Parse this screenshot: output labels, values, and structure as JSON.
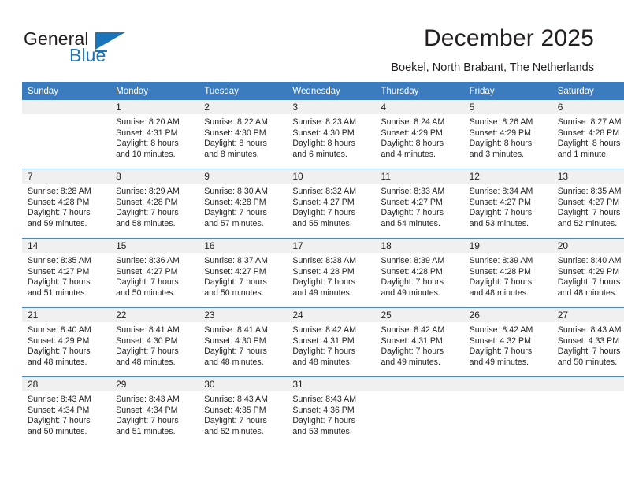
{
  "brand": {
    "name_part1": "General",
    "name_part2": "Blue"
  },
  "header": {
    "title": "December 2025",
    "subtitle": "Boekel, North Brabant, The Netherlands"
  },
  "colors": {
    "header_blue": "#3b7cbf",
    "brand_blue": "#1b75bb",
    "daynum_band": "#f0f0f0",
    "row_divider": "#4f86c2",
    "text": "#231f20"
  },
  "calendar": {
    "weekday_headers": [
      "Sunday",
      "Monday",
      "Tuesday",
      "Wednesday",
      "Thursday",
      "Friday",
      "Saturday"
    ],
    "weeks": [
      [
        {
          "day": "",
          "lines": []
        },
        {
          "day": "1",
          "lines": [
            "Sunrise: 8:20 AM",
            "Sunset: 4:31 PM",
            "Daylight: 8 hours",
            "and 10 minutes."
          ]
        },
        {
          "day": "2",
          "lines": [
            "Sunrise: 8:22 AM",
            "Sunset: 4:30 PM",
            "Daylight: 8 hours",
            "and 8 minutes."
          ]
        },
        {
          "day": "3",
          "lines": [
            "Sunrise: 8:23 AM",
            "Sunset: 4:30 PM",
            "Daylight: 8 hours",
            "and 6 minutes."
          ]
        },
        {
          "day": "4",
          "lines": [
            "Sunrise: 8:24 AM",
            "Sunset: 4:29 PM",
            "Daylight: 8 hours",
            "and 4 minutes."
          ]
        },
        {
          "day": "5",
          "lines": [
            "Sunrise: 8:26 AM",
            "Sunset: 4:29 PM",
            "Daylight: 8 hours",
            "and 3 minutes."
          ]
        },
        {
          "day": "6",
          "lines": [
            "Sunrise: 8:27 AM",
            "Sunset: 4:28 PM",
            "Daylight: 8 hours",
            "and 1 minute."
          ]
        }
      ],
      [
        {
          "day": "7",
          "lines": [
            "Sunrise: 8:28 AM",
            "Sunset: 4:28 PM",
            "Daylight: 7 hours",
            "and 59 minutes."
          ]
        },
        {
          "day": "8",
          "lines": [
            "Sunrise: 8:29 AM",
            "Sunset: 4:28 PM",
            "Daylight: 7 hours",
            "and 58 minutes."
          ]
        },
        {
          "day": "9",
          "lines": [
            "Sunrise: 8:30 AM",
            "Sunset: 4:28 PM",
            "Daylight: 7 hours",
            "and 57 minutes."
          ]
        },
        {
          "day": "10",
          "lines": [
            "Sunrise: 8:32 AM",
            "Sunset: 4:27 PM",
            "Daylight: 7 hours",
            "and 55 minutes."
          ]
        },
        {
          "day": "11",
          "lines": [
            "Sunrise: 8:33 AM",
            "Sunset: 4:27 PM",
            "Daylight: 7 hours",
            "and 54 minutes."
          ]
        },
        {
          "day": "12",
          "lines": [
            "Sunrise: 8:34 AM",
            "Sunset: 4:27 PM",
            "Daylight: 7 hours",
            "and 53 minutes."
          ]
        },
        {
          "day": "13",
          "lines": [
            "Sunrise: 8:35 AM",
            "Sunset: 4:27 PM",
            "Daylight: 7 hours",
            "and 52 minutes."
          ]
        }
      ],
      [
        {
          "day": "14",
          "lines": [
            "Sunrise: 8:35 AM",
            "Sunset: 4:27 PM",
            "Daylight: 7 hours",
            "and 51 minutes."
          ]
        },
        {
          "day": "15",
          "lines": [
            "Sunrise: 8:36 AM",
            "Sunset: 4:27 PM",
            "Daylight: 7 hours",
            "and 50 minutes."
          ]
        },
        {
          "day": "16",
          "lines": [
            "Sunrise: 8:37 AM",
            "Sunset: 4:27 PM",
            "Daylight: 7 hours",
            "and 50 minutes."
          ]
        },
        {
          "day": "17",
          "lines": [
            "Sunrise: 8:38 AM",
            "Sunset: 4:28 PM",
            "Daylight: 7 hours",
            "and 49 minutes."
          ]
        },
        {
          "day": "18",
          "lines": [
            "Sunrise: 8:39 AM",
            "Sunset: 4:28 PM",
            "Daylight: 7 hours",
            "and 49 minutes."
          ]
        },
        {
          "day": "19",
          "lines": [
            "Sunrise: 8:39 AM",
            "Sunset: 4:28 PM",
            "Daylight: 7 hours",
            "and 48 minutes."
          ]
        },
        {
          "day": "20",
          "lines": [
            "Sunrise: 8:40 AM",
            "Sunset: 4:29 PM",
            "Daylight: 7 hours",
            "and 48 minutes."
          ]
        }
      ],
      [
        {
          "day": "21",
          "lines": [
            "Sunrise: 8:40 AM",
            "Sunset: 4:29 PM",
            "Daylight: 7 hours",
            "and 48 minutes."
          ]
        },
        {
          "day": "22",
          "lines": [
            "Sunrise: 8:41 AM",
            "Sunset: 4:30 PM",
            "Daylight: 7 hours",
            "and 48 minutes."
          ]
        },
        {
          "day": "23",
          "lines": [
            "Sunrise: 8:41 AM",
            "Sunset: 4:30 PM",
            "Daylight: 7 hours",
            "and 48 minutes."
          ]
        },
        {
          "day": "24",
          "lines": [
            "Sunrise: 8:42 AM",
            "Sunset: 4:31 PM",
            "Daylight: 7 hours",
            "and 48 minutes."
          ]
        },
        {
          "day": "25",
          "lines": [
            "Sunrise: 8:42 AM",
            "Sunset: 4:31 PM",
            "Daylight: 7 hours",
            "and 49 minutes."
          ]
        },
        {
          "day": "26",
          "lines": [
            "Sunrise: 8:42 AM",
            "Sunset: 4:32 PM",
            "Daylight: 7 hours",
            "and 49 minutes."
          ]
        },
        {
          "day": "27",
          "lines": [
            "Sunrise: 8:43 AM",
            "Sunset: 4:33 PM",
            "Daylight: 7 hours",
            "and 50 minutes."
          ]
        }
      ],
      [
        {
          "day": "28",
          "lines": [
            "Sunrise: 8:43 AM",
            "Sunset: 4:34 PM",
            "Daylight: 7 hours",
            "and 50 minutes."
          ]
        },
        {
          "day": "29",
          "lines": [
            "Sunrise: 8:43 AM",
            "Sunset: 4:34 PM",
            "Daylight: 7 hours",
            "and 51 minutes."
          ]
        },
        {
          "day": "30",
          "lines": [
            "Sunrise: 8:43 AM",
            "Sunset: 4:35 PM",
            "Daylight: 7 hours",
            "and 52 minutes."
          ]
        },
        {
          "day": "31",
          "lines": [
            "Sunrise: 8:43 AM",
            "Sunset: 4:36 PM",
            "Daylight: 7 hours",
            "and 53 minutes."
          ]
        },
        {
          "day": "",
          "lines": []
        },
        {
          "day": "",
          "lines": []
        },
        {
          "day": "",
          "lines": []
        }
      ]
    ]
  }
}
